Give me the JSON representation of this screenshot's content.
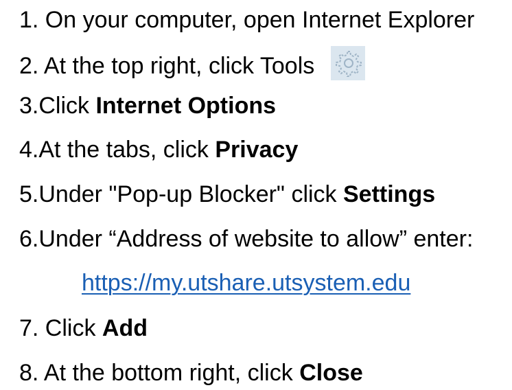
{
  "steps": [
    {
      "text": "1. On your computer, open Internet Explorer"
    },
    {
      "text": "2. At the top right, click Tools",
      "icon": "gear-icon"
    },
    {
      "prefix": "3.Click ",
      "bold": "Internet Options"
    },
    {
      "prefix": "4.At the tabs, click ",
      "bold": "Privacy"
    },
    {
      "prefix": "5.Under \"Pop-up Blocker\" click ",
      "bold": "Settings"
    },
    {
      "text": "6.Under “Address of website to allow” enter:"
    },
    {
      "link": "https://my.utshare.utsystem.edu"
    },
    {
      "prefix": "7. Click ",
      "bold": "Add"
    },
    {
      "prefix": "8. At the bottom right, click ",
      "bold": "Close"
    }
  ],
  "colors": {
    "text": "#000000",
    "link": "#1a5fb4",
    "icon_background": "#dbe6ef",
    "icon_stroke": "#9fb4c6"
  }
}
